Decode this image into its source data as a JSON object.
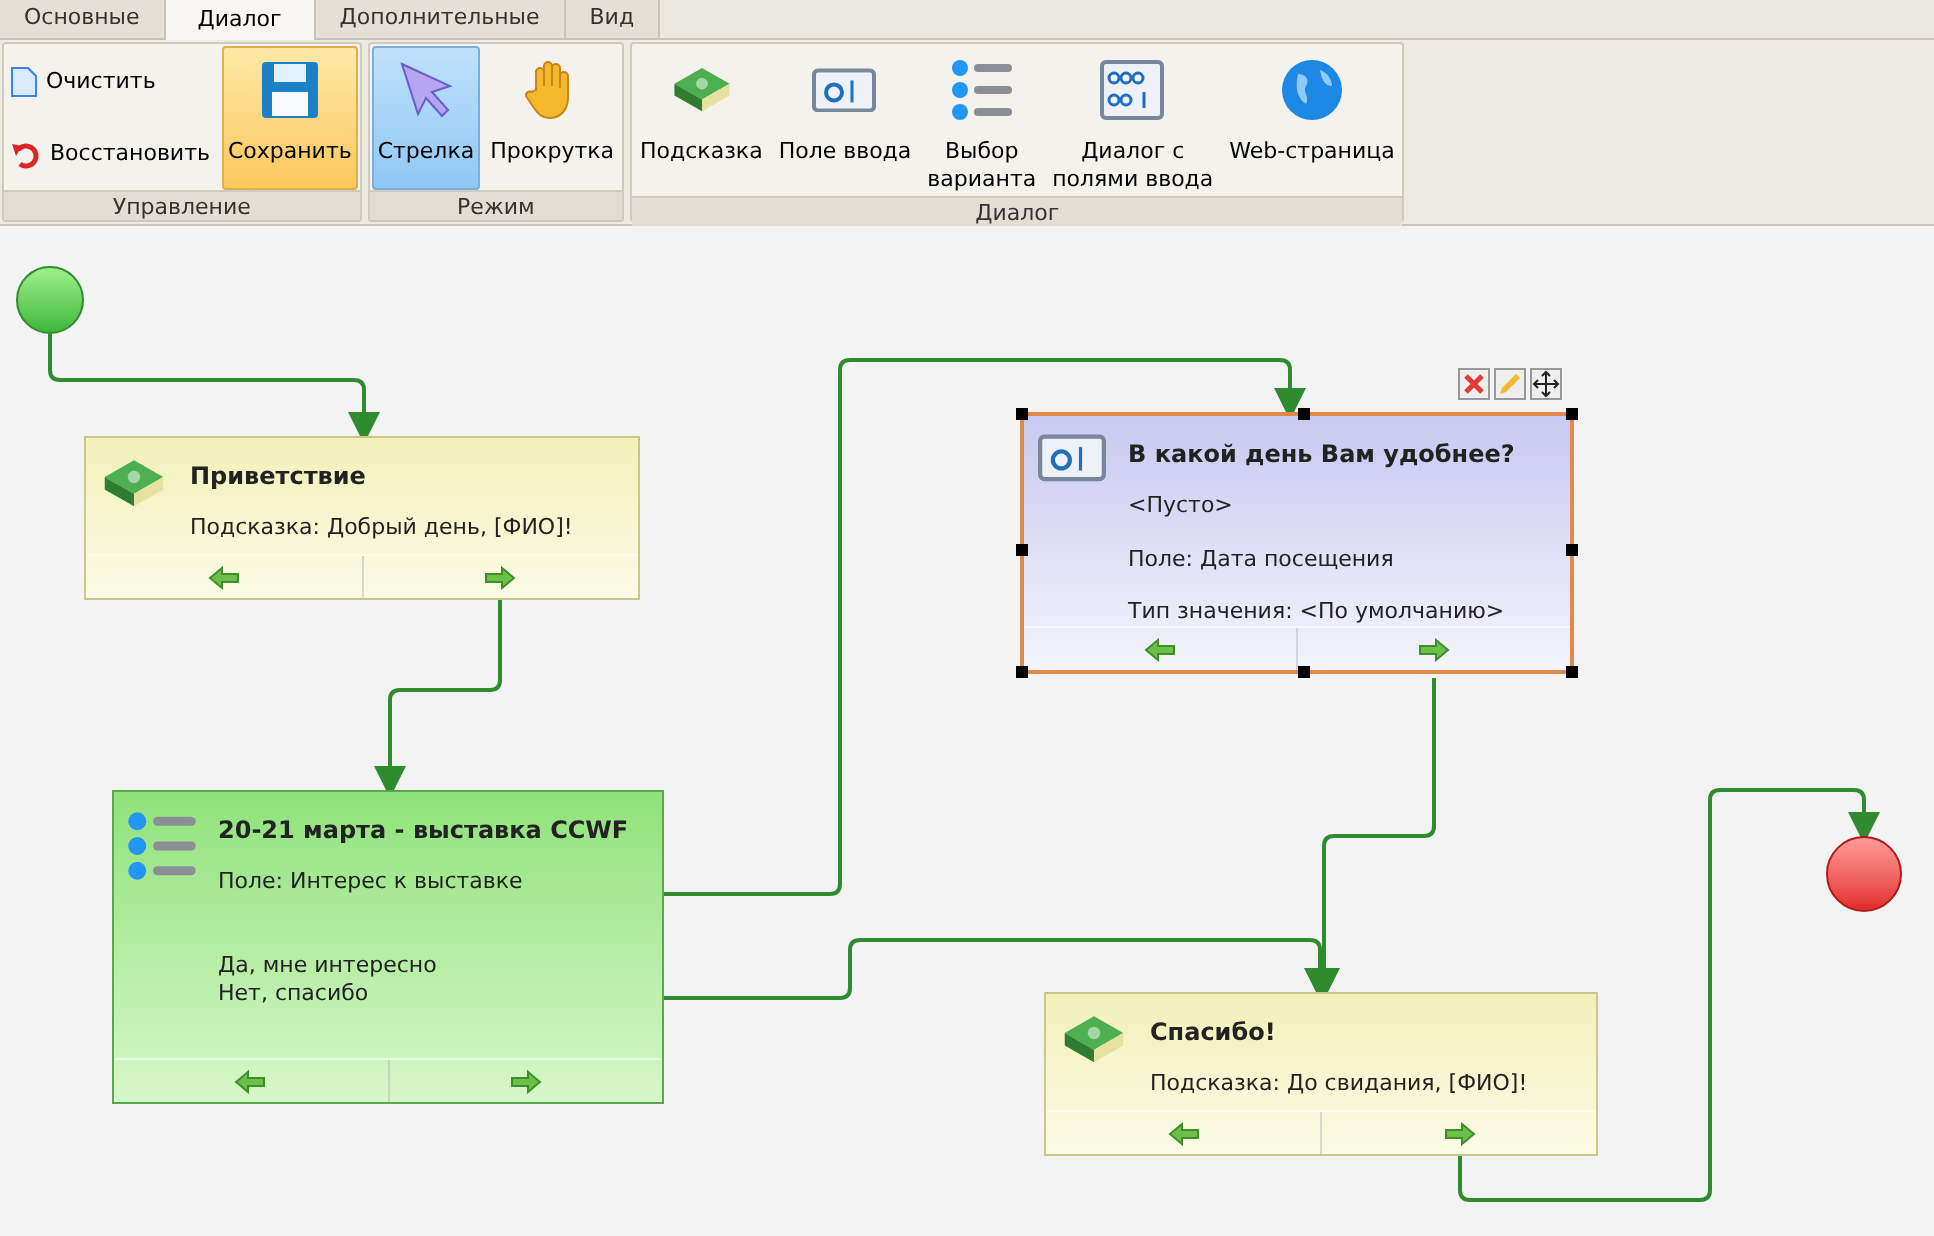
{
  "tabs": [
    {
      "label": "Основные",
      "selected": false
    },
    {
      "label": "Диалог",
      "selected": true
    },
    {
      "label": "Дополнительные",
      "selected": false
    },
    {
      "label": "Вид",
      "selected": false
    }
  ],
  "ribbon": {
    "groups": [
      {
        "label": "Управление",
        "small_buttons": [
          {
            "label": "Очистить",
            "kind": "page"
          },
          {
            "label": "Восстановить",
            "kind": "undo"
          }
        ],
        "buttons": [
          {
            "label": "Сохранить",
            "kind": "floppy",
            "highlighted": true
          }
        ]
      },
      {
        "label": "Режим",
        "buttons": [
          {
            "label": "Стрелка",
            "kind": "pointer",
            "selected": true
          },
          {
            "label": "Прокрутка",
            "kind": "hand",
            "selected": false
          }
        ]
      },
      {
        "label": "Диалог",
        "buttons": [
          {
            "label": "Подсказка",
            "kind": "book"
          },
          {
            "label": "Поле ввода",
            "kind": "input"
          },
          {
            "label": "Выбор\nварианта",
            "kind": "list"
          },
          {
            "label": "Диалог с\nполями ввода",
            "kind": "fields"
          },
          {
            "label": "Web-страница",
            "kind": "globe"
          }
        ]
      }
    ]
  },
  "nodes": [
    {
      "kind": "hint",
      "title": "Приветствие",
      "lines": [
        "Подсказка: Добрый день, [ФИО]!"
      ],
      "selected": false
    },
    {
      "kind": "choice",
      "title": "20-21 марта - выставка CCWF",
      "lines": [
        "Поле: Интерес к выставке"
      ],
      "options": [
        "Да, мне интересно",
        "Нет, спасибо"
      ],
      "selected": false
    },
    {
      "kind": "input",
      "title": "В какой день Вам удобнее?",
      "lines": [
        "<Пусто>",
        "Поле: Дата посещения",
        "Тип значения: <По умолчанию>"
      ],
      "selected": true
    },
    {
      "kind": "hint",
      "title": "Спасибо!",
      "lines": [
        "Подсказка: До свидания, [ФИО]!"
      ],
      "selected": false
    }
  ]
}
